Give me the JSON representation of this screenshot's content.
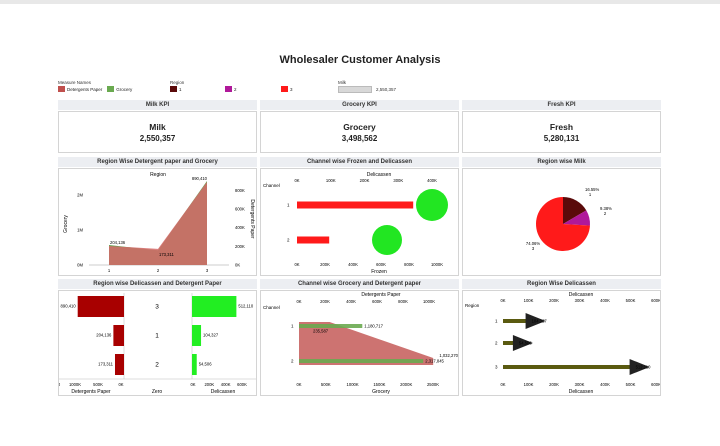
{
  "title": "Wholesaler Customer Analysis",
  "legends": {
    "measure_names": {
      "label": "Measure Names",
      "items": [
        {
          "name": "Detergents Paper",
          "color": "#c0504d"
        },
        {
          "name": "Grocery",
          "color": "#6aaa50"
        }
      ]
    },
    "region": {
      "label": "Region",
      "items": [
        {
          "name": "1",
          "color": "#5a0a0a"
        },
        {
          "name": "2",
          "color": "#b0189a"
        },
        {
          "name": "3",
          "color": "#ff1a1a"
        }
      ]
    },
    "milk": {
      "label": "Milk",
      "value": "2,550,357"
    }
  },
  "kpis": [
    {
      "header": "Milk KPI",
      "name": "Milk",
      "value": "2,550,357"
    },
    {
      "header": "Grocery KPI",
      "name": "Grocery",
      "value": "3,498,562"
    },
    {
      "header": "Fresh KPI",
      "name": "Fresh",
      "value": "5,280,131"
    }
  ],
  "panel_titles": {
    "p1": "Region Wise Detergent paper and Grocery",
    "p2": "Channel wise Frozen and Delicassen",
    "p3": "Region wise Milk",
    "p4": "Region wise Delicassen and Detergent Paper",
    "p5": "Channel wise Grocery and Detergent paper",
    "p6": "Region Wise Delicassen"
  },
  "chart_data": [
    {
      "type": "area",
      "title": "Region Wise Detergent paper and Grocery",
      "top_label": "Region",
      "categories": [
        "1",
        "2",
        "3"
      ],
      "series": [
        {
          "name": "Grocery",
          "axis": "left",
          "values": [
            570000,
            420000,
            2400000
          ],
          "color": "#5a9e46"
        },
        {
          "name": "Detergents Paper",
          "axis": "right",
          "values": [
            204136,
            173311,
            890410
          ],
          "color": "#d66a6a"
        }
      ],
      "left_axis": {
        "label": "Grocery",
        "ticks": [
          "0M",
          "1M",
          "2M"
        ],
        "range": [
          0,
          2400000
        ]
      },
      "right_axis": {
        "label": "Detergents Paper",
        "ticks": [
          "0K",
          "200K",
          "400K",
          "600K",
          "800K"
        ],
        "range": [
          0,
          900000
        ]
      },
      "data_labels": [
        "204,136",
        "173,311",
        "890,410"
      ]
    },
    {
      "type": "bar",
      "title": "Channel wise Frozen and Delicassen",
      "row_header": "Channel",
      "categories": [
        "1",
        "2"
      ],
      "series": [
        {
          "name": "Frozen",
          "values": [
            830000,
            230000
          ],
          "color": "#ff1a1a"
        },
        {
          "name": "Delicassen",
          "values": [
            450000,
            300000
          ],
          "color": "#22e622"
        }
      ],
      "x_bottom": {
        "label": "Frozen",
        "ticks": [
          "0K",
          "200K",
          "400K",
          "600K",
          "800K",
          "1000K"
        ]
      },
      "x_top": {
        "label": "Delicassen",
        "ticks": [
          "0K",
          "100K",
          "200K",
          "300K",
          "400K"
        ]
      }
    },
    {
      "type": "pie",
      "title": "Region wise Milk",
      "slices": [
        {
          "region": "1",
          "value": 16.55,
          "label": "16.55%",
          "sub": "1",
          "color": "#5a0a0a"
        },
        {
          "region": "2",
          "value": 9.38,
          "label": "9.38%",
          "sub": "2",
          "color": "#b0189a"
        },
        {
          "region": "3",
          "value": 74.06,
          "label": "74.06%",
          "sub": "3",
          "color": "#ff1a1a"
        }
      ]
    },
    {
      "type": "bar",
      "title": "Region wise Delicassen and Detergent Paper",
      "rows": [
        "3",
        "1",
        "2"
      ],
      "detergents_paper": [
        890410,
        204136,
        173311
      ],
      "detergents_labels": [
        "890,410",
        "204,136",
        "173,311"
      ],
      "delicassen": [
        512110,
        104327,
        54506
      ],
      "delicassen_labels": [
        "512,110",
        "104,327",
        "54,506"
      ],
      "left_axis": {
        "label": "Detergents Paper",
        "ticks": [
          "1000K",
          "500K",
          "0K"
        ]
      },
      "middle_axis": {
        "label": "Zero",
        "ticks": [
          "0"
        ]
      },
      "right_axis": {
        "label": "Delicassen",
        "ticks": [
          "0K",
          "200K",
          "400K",
          "600K"
        ]
      },
      "colors": {
        "detergents": "#a80000",
        "delicassen": "#22ee22"
      }
    },
    {
      "type": "area",
      "title": "Channel wise Grocery and Detergent paper",
      "row_header": "Channel",
      "categories": [
        "1",
        "2"
      ],
      "grocery": [
        1180717,
        2317845
      ],
      "grocery_labels": [
        "1,180,717",
        "2,317,845"
      ],
      "detergents_paper": [
        235587,
        1032270
      ],
      "detergents_labels": [
        "235,587",
        "1,032,270"
      ],
      "x_bottom": {
        "label": "Grocery",
        "ticks": [
          "0K",
          "500K",
          "1000K",
          "1500K",
          "2000K",
          "2500K"
        ]
      },
      "x_top": {
        "label": "Detergents Paper",
        "ticks": [
          "0K",
          "200K",
          "400K",
          "600K",
          "800K",
          "1000K"
        ]
      }
    },
    {
      "type": "bar",
      "title": "Region Wise Delicassen",
      "row_header": "Region",
      "categories": [
        "1",
        "2",
        "3"
      ],
      "values": [
        104327,
        54506,
        512110
      ],
      "value_labels": [
        "104,327",
        "54,506",
        "512,110"
      ],
      "x_bottom": {
        "label": "Delicassen",
        "ticks": [
          "0K",
          "100K",
          "200K",
          "300K",
          "400K",
          "500K",
          "600K"
        ]
      },
      "x_top": {
        "label": "Delicassen",
        "ticks": [
          "0K",
          "100K",
          "200K",
          "300K",
          "400K",
          "500K",
          "600K"
        ]
      },
      "color": "#5a5a10"
    }
  ]
}
